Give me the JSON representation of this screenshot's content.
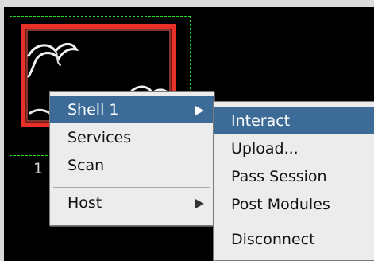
{
  "canvas": {
    "background": "#000000",
    "node_frame_color": "#e8302a",
    "selection_color": "#22dd22"
  },
  "host": {
    "label": "1"
  },
  "context_menu": {
    "items": [
      {
        "label": "Shell 1",
        "has_submenu": true,
        "active": true
      },
      {
        "label": "Services",
        "has_submenu": false
      },
      {
        "label": "Scan",
        "has_submenu": false
      },
      {
        "label": "Host",
        "has_submenu": true
      }
    ]
  },
  "submenu": {
    "items": [
      {
        "label": "Interact",
        "active": true
      },
      {
        "label": "Upload..."
      },
      {
        "label": "Pass Session"
      },
      {
        "label": "Post Modules"
      },
      {
        "label": "Disconnect"
      }
    ]
  },
  "colors": {
    "menu_bg": "#ececec",
    "highlight": "#3b6b96",
    "highlight_text": "#ffffff"
  }
}
